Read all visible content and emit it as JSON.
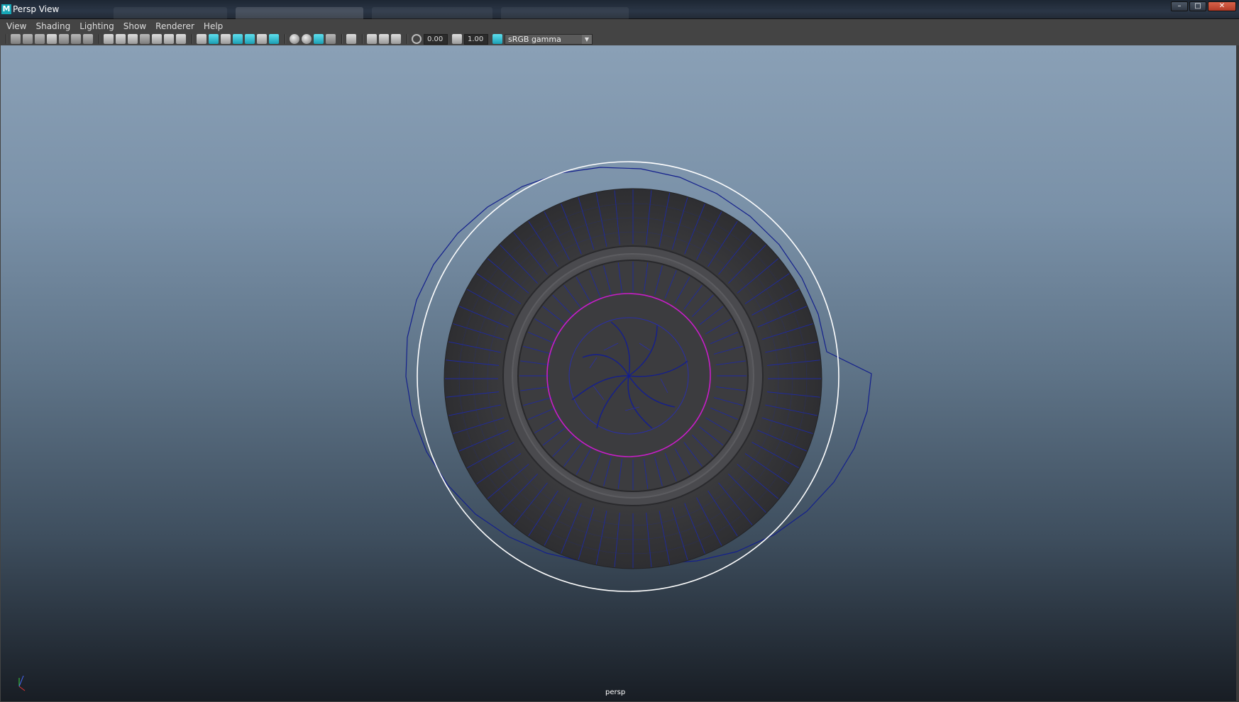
{
  "window": {
    "title": "Persp View",
    "app_icon_letter": "M",
    "controls": {
      "minimize": "–",
      "maximize": "□",
      "close": "✕"
    }
  },
  "menubar": {
    "items": [
      "View",
      "Shading",
      "Lighting",
      "Show",
      "Renderer",
      "Help"
    ]
  },
  "toolbar": {
    "exposure_value": "0.00",
    "gamma_value": "1.00",
    "color_space": "sRGB gamma",
    "dropdown_arrow": "▼"
  },
  "viewport": {
    "camera_label": "persp",
    "axis_labels": {
      "y": "y",
      "x": "x",
      "z": "z"
    },
    "gradient_top": "#8aa0b6",
    "gradient_bottom": "#181d24",
    "wire_blue": "#14208c",
    "wire_white": "#ffffff",
    "wire_magenta": "#c81ec8"
  }
}
